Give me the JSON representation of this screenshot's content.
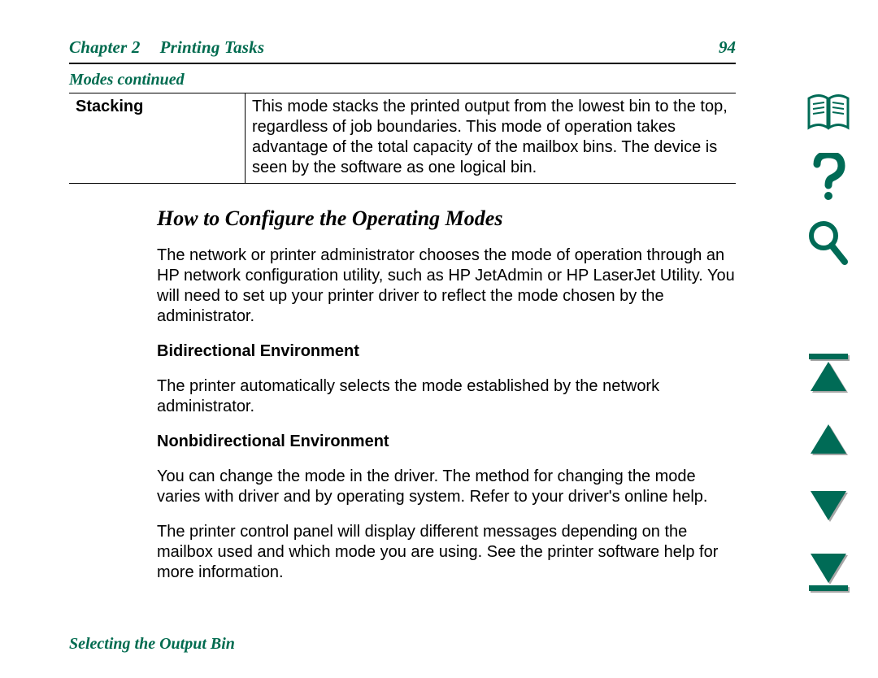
{
  "header": {
    "chapter_label": "Chapter 2",
    "chapter_title": "Printing Tasks",
    "page_number": "94"
  },
  "section": {
    "continued_label": "Modes continued"
  },
  "table": {
    "row_label": "Stacking",
    "row_text": "This mode stacks the printed output from the lowest bin to the top, regardless of job boundaries. This mode of operation takes advantage of the total capacity of the mailbox bins. The device is seen by the software as one logical bin."
  },
  "subheading": "How to Configure the Operating Modes",
  "paragraphs": {
    "intro": "The network or printer administrator chooses the mode of operation through an HP network configuration utility, such as HP JetAdmin or HP LaserJet Utility. You will need to set up your printer driver to reflect the mode chosen by the administrator.",
    "bidi_heading": "Bidirectional Environment",
    "bidi_text": "The printer automatically selects the mode established by the network administrator.",
    "nonbidi_heading": "Nonbidirectional Environment",
    "nonbidi_text1": "You can change the mode in the driver. The method for changing the mode varies with driver and by operating system. Refer to your driver's online help.",
    "nonbidi_text2": "The printer control panel will display different messages depending on the mailbox used and which mode you are using. See the printer software help for more information."
  },
  "footer": {
    "section_title": "Selecting the Output Bin"
  }
}
